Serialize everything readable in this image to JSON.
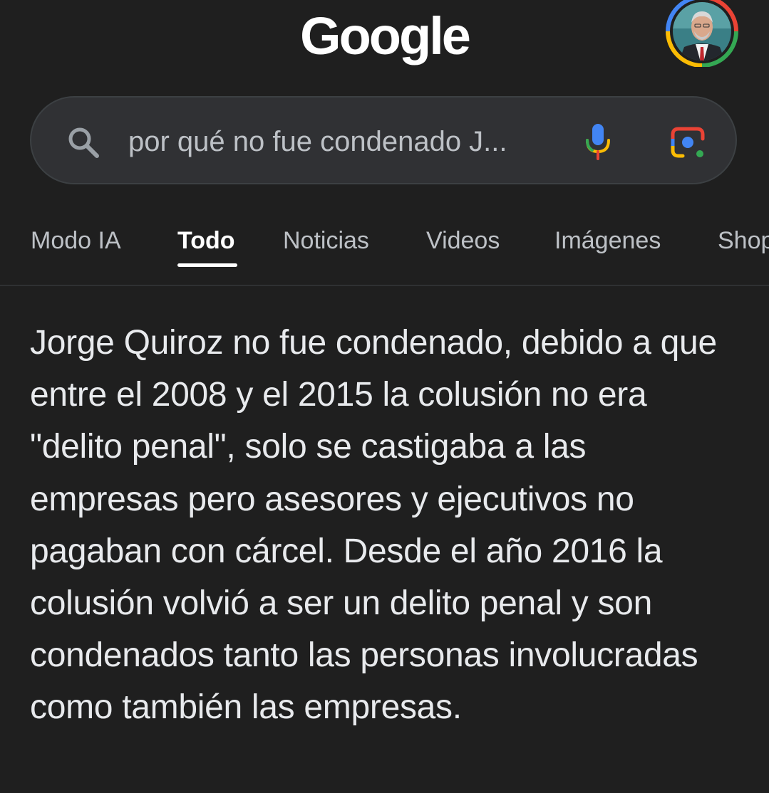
{
  "header": {
    "logo_text": "Google"
  },
  "search": {
    "query": "por qué no fue condenado J..."
  },
  "tabs": [
    {
      "label": "Modo IA",
      "active": false
    },
    {
      "label": "Todo",
      "active": true
    },
    {
      "label": "Noticias",
      "active": false
    },
    {
      "label": "Videos",
      "active": false
    },
    {
      "label": "Imágenes",
      "active": false
    },
    {
      "label": "Shop",
      "active": false
    }
  ],
  "answer": {
    "text": "Jorge Quiroz no fue condenado, debido a que entre el 2008 y el 2015 la colusión no era \"delito penal\", solo se castigaba a las empresas pero asesores y ejecutivos no pagaban con cárcel. Desde el año 2016 la colusión volvió a ser un delito penal y son condenados tanto las personas involucradas como también las empresas."
  },
  "icons": {
    "search": "search-icon",
    "mic": "mic-icon",
    "lens": "google-lens-icon",
    "avatar": "profile-avatar"
  },
  "colors": {
    "background": "#1f1f1f",
    "search_bar": "#303134",
    "google_blue": "#4285f4",
    "google_red": "#ea4335",
    "google_yellow": "#fbbc04",
    "google_green": "#34a853"
  }
}
